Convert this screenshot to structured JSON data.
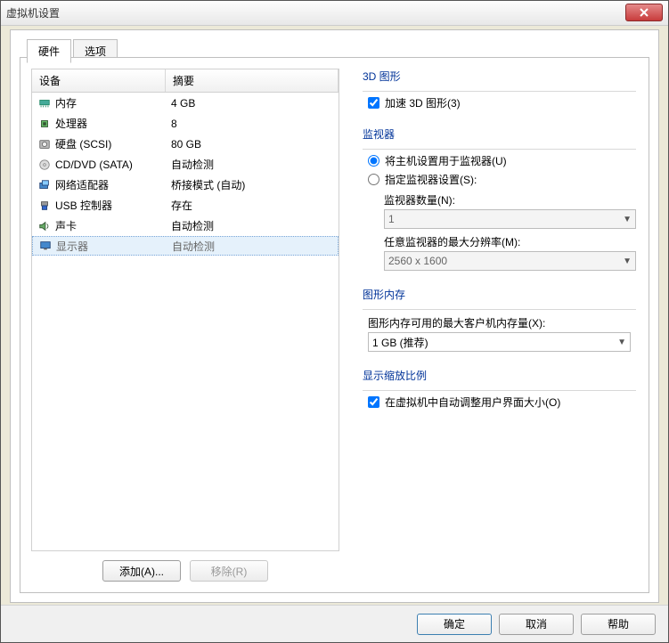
{
  "window": {
    "title": "虚拟机设置"
  },
  "tabs": {
    "hardware": "硬件",
    "options": "选项"
  },
  "table": {
    "col_device": "设备",
    "col_summary": "摘要",
    "rows": [
      {
        "icon": "memory",
        "device": "内存",
        "summary": "4 GB"
      },
      {
        "icon": "cpu",
        "device": "处理器",
        "summary": "8"
      },
      {
        "icon": "disk",
        "device": "硬盘 (SCSI)",
        "summary": "80 GB"
      },
      {
        "icon": "cd",
        "device": "CD/DVD (SATA)",
        "summary": "自动检测"
      },
      {
        "icon": "net",
        "device": "网络适配器",
        "summary": "桥接模式 (自动)"
      },
      {
        "icon": "usb",
        "device": "USB 控制器",
        "summary": "存在"
      },
      {
        "icon": "sound",
        "device": "声卡",
        "summary": "自动检测"
      },
      {
        "icon": "display",
        "device": "显示器",
        "summary": "自动检测"
      }
    ],
    "selected": 7
  },
  "buttons": {
    "add": "添加(A)...",
    "remove": "移除(R)"
  },
  "right": {
    "g3d": {
      "title": "3D 图形",
      "accel": "加速 3D 图形(3)",
      "accel_checked": true
    },
    "monitors": {
      "title": "监视器",
      "use_host": "将主机设置用于监视器(U)",
      "specify": "指定监视器设置(S):",
      "selected": "use_host",
      "count_label": "监视器数量(N):",
      "count_value": "1",
      "maxres_label": "任意监视器的最大分辨率(M):",
      "maxres_value": "2560 x 1600"
    },
    "gmem": {
      "title": "图形内存",
      "label": "图形内存可用的最大客户机内存量(X):",
      "value": "1 GB (推荐)"
    },
    "scale": {
      "title": "显示缩放比例",
      "auto": "在虚拟机中自动调整用户界面大小(O)",
      "auto_checked": true
    }
  },
  "footer": {
    "ok": "确定",
    "cancel": "取消",
    "help": "帮助"
  }
}
